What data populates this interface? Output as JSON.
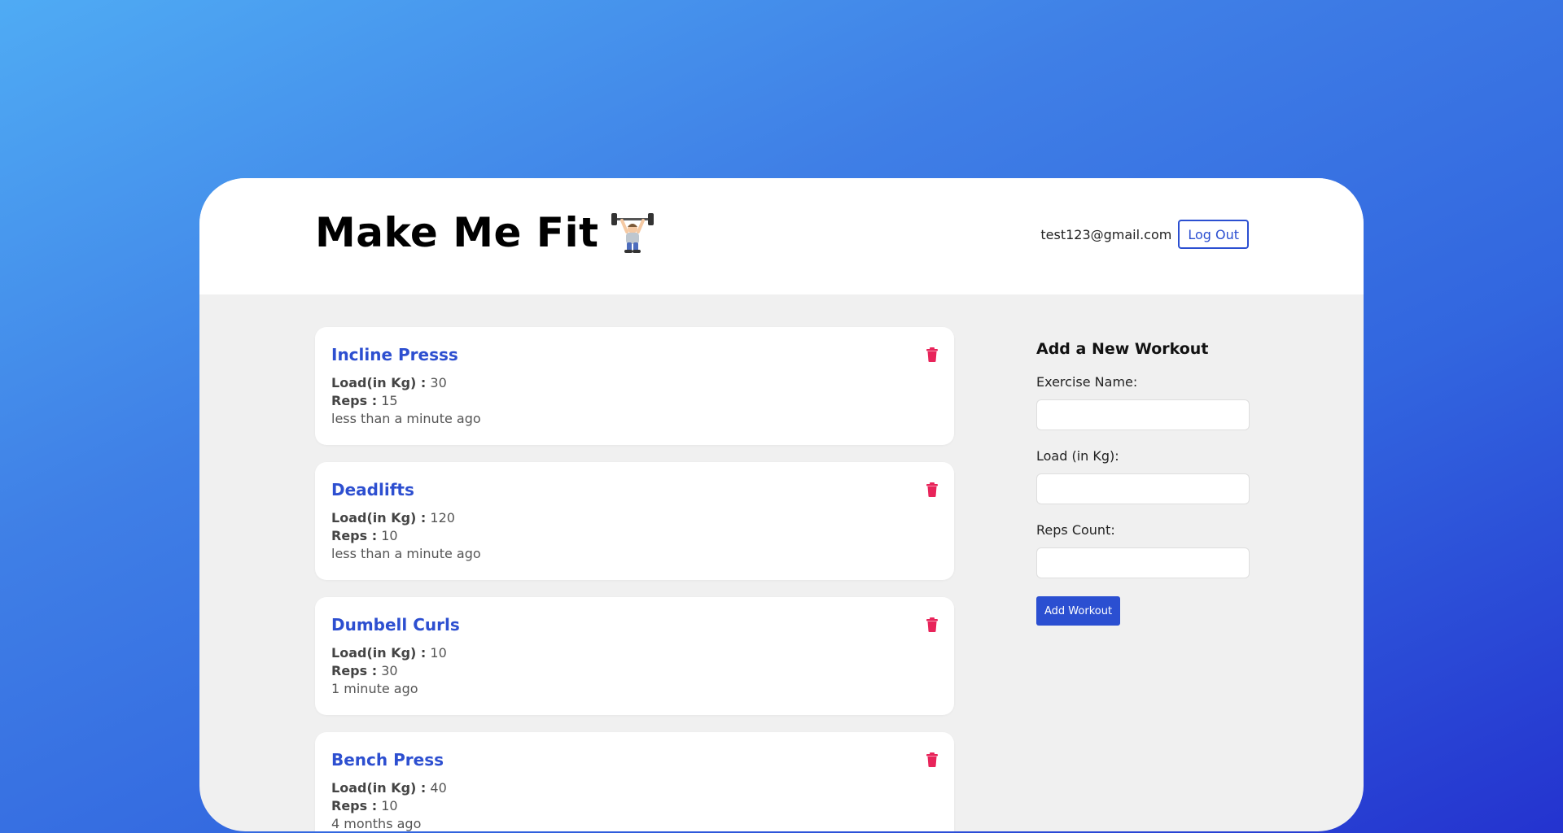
{
  "header": {
    "title": "Make Me Fit",
    "title_icon": "weight-lifter-icon",
    "user_email": "test123@gmail.com",
    "logout_label": "Log Out"
  },
  "workouts": [
    {
      "title": "Incline Presss",
      "load_label": "Load(in Kg) :",
      "load": "30",
      "reps_label": "Reps :",
      "reps": "15",
      "time": "less than a minute ago"
    },
    {
      "title": "Deadlifts",
      "load_label": "Load(in Kg) :",
      "load": "120",
      "reps_label": "Reps :",
      "reps": "10",
      "time": "less than a minute ago"
    },
    {
      "title": "Dumbell Curls",
      "load_label": "Load(in Kg) :",
      "load": "10",
      "reps_label": "Reps :",
      "reps": "30",
      "time": "1 minute ago"
    },
    {
      "title": "Bench Press",
      "load_label": "Load(in Kg) :",
      "load": "40",
      "reps_label": "Reps :",
      "reps": "10",
      "time": "4 months ago"
    }
  ],
  "form": {
    "heading": "Add a New Workout",
    "exercise_label": "Exercise Name:",
    "exercise_value": "",
    "load_label": "Load (in Kg):",
    "load_value": "",
    "reps_label": "Reps Count:",
    "reps_value": "",
    "submit_label": "Add Workout"
  },
  "colors": {
    "accent": "#2b4fd1",
    "delete": "#e8245a",
    "panel_bg": "#f0f0f0"
  },
  "icons": {
    "delete": "trash-icon"
  }
}
